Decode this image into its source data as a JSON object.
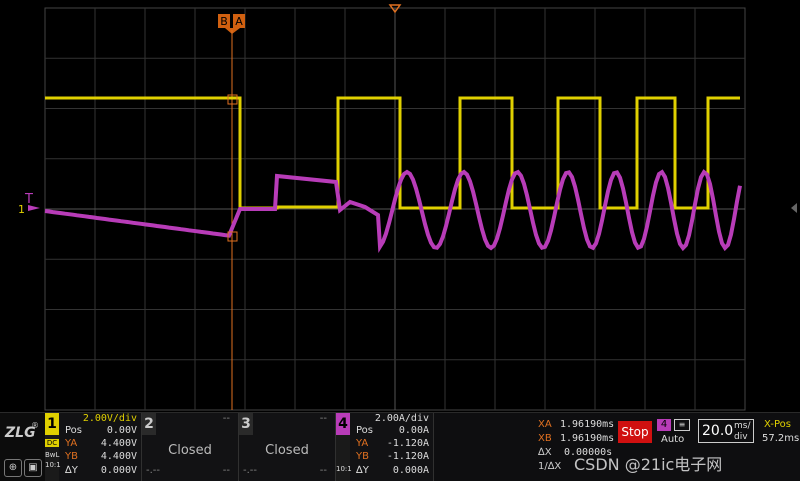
{
  "cursor_markers": {
    "b": "B",
    "a": "A"
  },
  "trigger_marker": "T",
  "ch1_marker": "1",
  "channels": [
    {
      "num": "1",
      "scale": "2.00V/div",
      "pos_label": "Pos",
      "pos": "0.00V",
      "ya_label": "YA",
      "ya": "4.400V",
      "yb_label": "YB",
      "yb": "4.400V",
      "dy_label": "∆Y",
      "dy": "0.000V",
      "side_top": "DC",
      "side_mid": "BwL",
      "side_bot": "10:1",
      "color": "#e0d000"
    },
    {
      "num": "2",
      "top": "--",
      "status": "Closed",
      "dash_bl": "-.--",
      "dash_br": "--",
      "color": "#bbbbbb"
    },
    {
      "num": "3",
      "top": "--",
      "status": "Closed",
      "dash_bl": "-.--",
      "dash_br": "--",
      "color": "#bbbbbb"
    },
    {
      "num": "4",
      "scale": "2.00A/div",
      "pos_label": "Pos",
      "pos": "0.00A",
      "ya_label": "YA",
      "ya": "-1.120A",
      "yb_label": "YB",
      "yb": "-1.120A",
      "dy_label": "∆Y",
      "dy": "0.000A",
      "side_bot": "10:1",
      "color": "#b83cb8"
    }
  ],
  "cursors": {
    "xa_label": "XA",
    "xa": "1.96190ms",
    "xb_label": "XB",
    "xb": "1.96190ms",
    "dx_label": "∆X",
    "dx": "0.00000s",
    "inv_dx_label": "1/∆X"
  },
  "run_state": "Stop",
  "trigger": {
    "source": "4",
    "mode": "Auto"
  },
  "timebase": {
    "value": "20.0",
    "unit_top": "ms/",
    "unit_bot": "div"
  },
  "xpos": {
    "label": "X-Pos",
    "value": "57.2ms"
  },
  "watermark": "CSDN @21ic电子网",
  "logo": "ZLG",
  "colors": {
    "ch1": "#e0d000",
    "ch4": "#b83cb8",
    "cursor": "#e07020",
    "grid": "#3a3a3a"
  }
}
